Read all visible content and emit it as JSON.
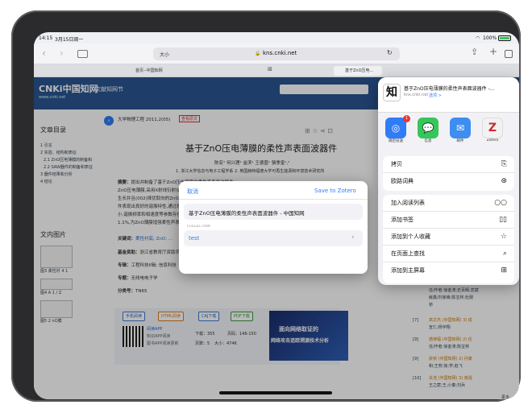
{
  "status": {
    "time": "14:15",
    "date": "3月15日周一",
    "battery": "100%"
  },
  "browser": {
    "url": "kns.cnki.net",
    "text_size": "大小"
  },
  "tabs": [
    {
      "label": "首页--中国知网"
    },
    {
      "label": "基于ZnO压电..."
    }
  ],
  "cnki": {
    "logo": "CNKi中国知网",
    "logo_sub": "www.cnki.net",
    "nav_title": "文献知网节"
  },
  "article": {
    "source": "大学物理工程 2011,2(05)",
    "tag": "查看原文",
    "title": "基于ZnO压电薄膜的柔性声表面波器件",
    "authors": "陈宏¹ 何兴理¹ 金滨¹ 王德茵¹ 骆季奎¹,²",
    "affiliation": "1. 浙江大学信息与电子工程学系  2. 英国赫特福德大学可再生能源和环境技术研究所",
    "abstract_label": "摘要：",
    "abstract_lines": [
      "提出并制备了基于ZnO压电薄膜的柔性声表面波器件",
      "ZnO压电薄膜,采用X射线衍射仪对薄膜的晶体结构进行表征",
      "生长并且(002)择优取向的ZnO压电薄膜的声表面波器件",
      "件表现出良好的谐振特性,通过理论计算其频率与实验结果",
      "小,谐振频率和相速度等参数存在一定偏差,该器件的",
      "1.1%,为ZnO薄膜增强柔性声表面波器件研究提供参考"
    ],
    "keywords_label": "关键词：",
    "keywords": "柔性衬底; ZnO; ...",
    "fund_label": "基金资助：",
    "fund": "浙江省教育厅资助项目 (No.Y200805433);",
    "major_label": "专辑：",
    "major": "工程科技II辑; 信息科技",
    "topic_label": "专题：",
    "topic": "无线电电子学",
    "class_label": "分类号：",
    "class_no": "TN65"
  },
  "toc": {
    "title": "文章目录",
    "items": [
      "1 引言",
      "2 实验、结构和表征",
      "2.1 ZnO压电薄膜的制备和",
      "2.2 SAW器件的制备和表征",
      "3 器件结果和分析",
      "4 结论"
    ]
  },
  "figures": {
    "title": "文内图片",
    "captions": [
      "图3 柔性衬 4 1",
      "图4 A 1 / Z",
      "图5 2 nO膜"
    ]
  },
  "downloads": {
    "buttons": [
      "手机阅读",
      "HTML阅读",
      "CAJ下载",
      "PDF下载"
    ],
    "app_text": [
      "阅读APP",
      "知识APP阅读",
      "图书APP阅读更新"
    ],
    "stats": [
      "下载：355",
      "页码：146-150",
      "页数：5",
      "大小：474K"
    ]
  },
  "ad": {
    "line1": "面向网络取证的",
    "line2": "网络攻击追踪溯源技术分析"
  },
  "references": [
    {
      "num": "[6]",
      "lines": [
        "查看原文 (中国知网) 2) 任",
        "任/作者:徐金涛;史百辉;蕊斌",
        "嵌鑫/刘家峰;陈宝林;杜朋",
        "桥"
      ]
    },
    {
      "num": "[7]",
      "lines": [
        "高文杰 (中国知网) 3) 成",
        "宣仁;杨宇翔"
      ]
    },
    {
      "num": "[9]",
      "lines": [
        "德津福 (中国知网) 2) 任",
        "任/作者:徐金涛;陈宝林"
      ]
    },
    {
      "num": "[9]",
      "lines": [
        "获祯 (中国知网) 2) 孙康",
        "和;王劳;徐;学;赵飞"
      ]
    },
    {
      "num": "[10]",
      "lines": [
        "关浩 (中国知网) 3) 南强",
        "王之宸;王;小秦;刘兵"
      ]
    }
  ],
  "more_label": "更多",
  "share_sheet": {
    "title": "基于ZnO压电薄膜的柔性声表面波器件 -...",
    "subtitle": "kns.cnki.net",
    "options_label": "选项 >",
    "apps": [
      {
        "label": "隔空投送",
        "icon": "airdrop-icon",
        "color": "#2f7cf6",
        "badge": "1"
      },
      {
        "label": "信息",
        "icon": "messages-icon",
        "color": "#34c759"
      },
      {
        "label": "邮件",
        "icon": "mail-icon",
        "color": "#3d8ef0"
      },
      {
        "label": "Zotero",
        "icon": "zotero-icon",
        "color": "#cc2936"
      }
    ],
    "group1": [
      {
        "label": "拷贝",
        "icon": "copy-icon",
        "glyph": "⎘"
      },
      {
        "label": "欧路词典",
        "icon": "dictionary-icon",
        "glyph": "⊛"
      }
    ],
    "group2": [
      {
        "label": "加入阅读列表",
        "icon": "glasses-icon",
        "glyph": "○○"
      },
      {
        "label": "添加书签",
        "icon": "book-icon",
        "glyph": "▯▯"
      },
      {
        "label": "添加到个人收藏",
        "icon": "star-icon",
        "glyph": "☆"
      },
      {
        "label": "在页面上查找",
        "icon": "search-icon",
        "glyph": "⌕"
      },
      {
        "label": "添加到主屏幕",
        "icon": "add-square-icon",
        "glyph": "⊞"
      }
    ]
  },
  "zotero_dialog": {
    "cancel": "取消",
    "save": "Save to Zotero",
    "item_title": "基于ZnO压电薄膜的柔性声表面波器件 - 中国知网",
    "collection_header": "COLLECTION",
    "collection_value": "test"
  },
  "colors": {
    "accent": "#2f7cf6",
    "cnki_blue": "#2a5592",
    "zotero_red": "#cc2936",
    "ref_orange": "#d07a00"
  }
}
